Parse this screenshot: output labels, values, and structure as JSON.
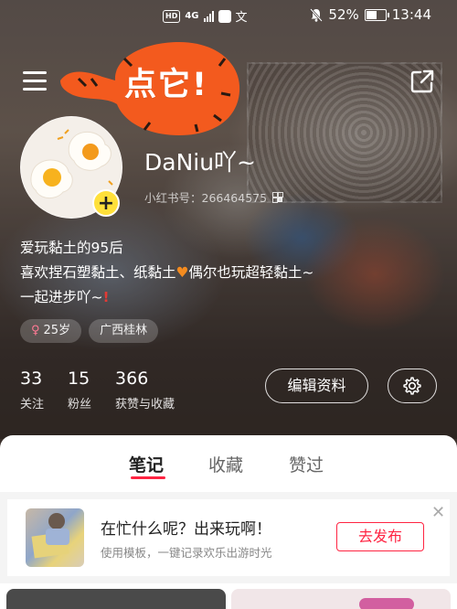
{
  "status_bar": {
    "network_badge": "HD",
    "network_type": "4G",
    "app_icon_text": "文",
    "battery": "52%",
    "time": "13:44"
  },
  "header": {
    "menu_icon": "hamburger-menu-icon",
    "share_icon": "share-external-icon",
    "callout_text": "点它!"
  },
  "profile": {
    "username": "DaNiu吖~",
    "redbook_id": "小红书号：266464575",
    "bio_lines": [
      "爱玩黏土的95后",
      "喜欢捏石塑黏土、纸黏土",
      "偶尔也玩超轻黏土~",
      "一起进步吖~"
    ],
    "tags": {
      "age": "25岁",
      "location": "广西桂林"
    },
    "stats": [
      {
        "num": "33",
        "label": "关注"
      },
      {
        "num": "15",
        "label": "粉丝"
      },
      {
        "num": "366",
        "label": "获赞与收藏"
      }
    ],
    "edit_label": "编辑资料"
  },
  "tabs": {
    "items": [
      "笔记",
      "收藏",
      "赞过"
    ],
    "active": "笔记"
  },
  "banner": {
    "title": "在忙什么呢？出来玩啊！",
    "subtitle": "使用模板，一键记录欢乐出游时光",
    "button": "去发布"
  },
  "colors": {
    "accent": "#ff2442",
    "callout": "#f35a1e",
    "avatar_badge": "#ffe03a"
  }
}
